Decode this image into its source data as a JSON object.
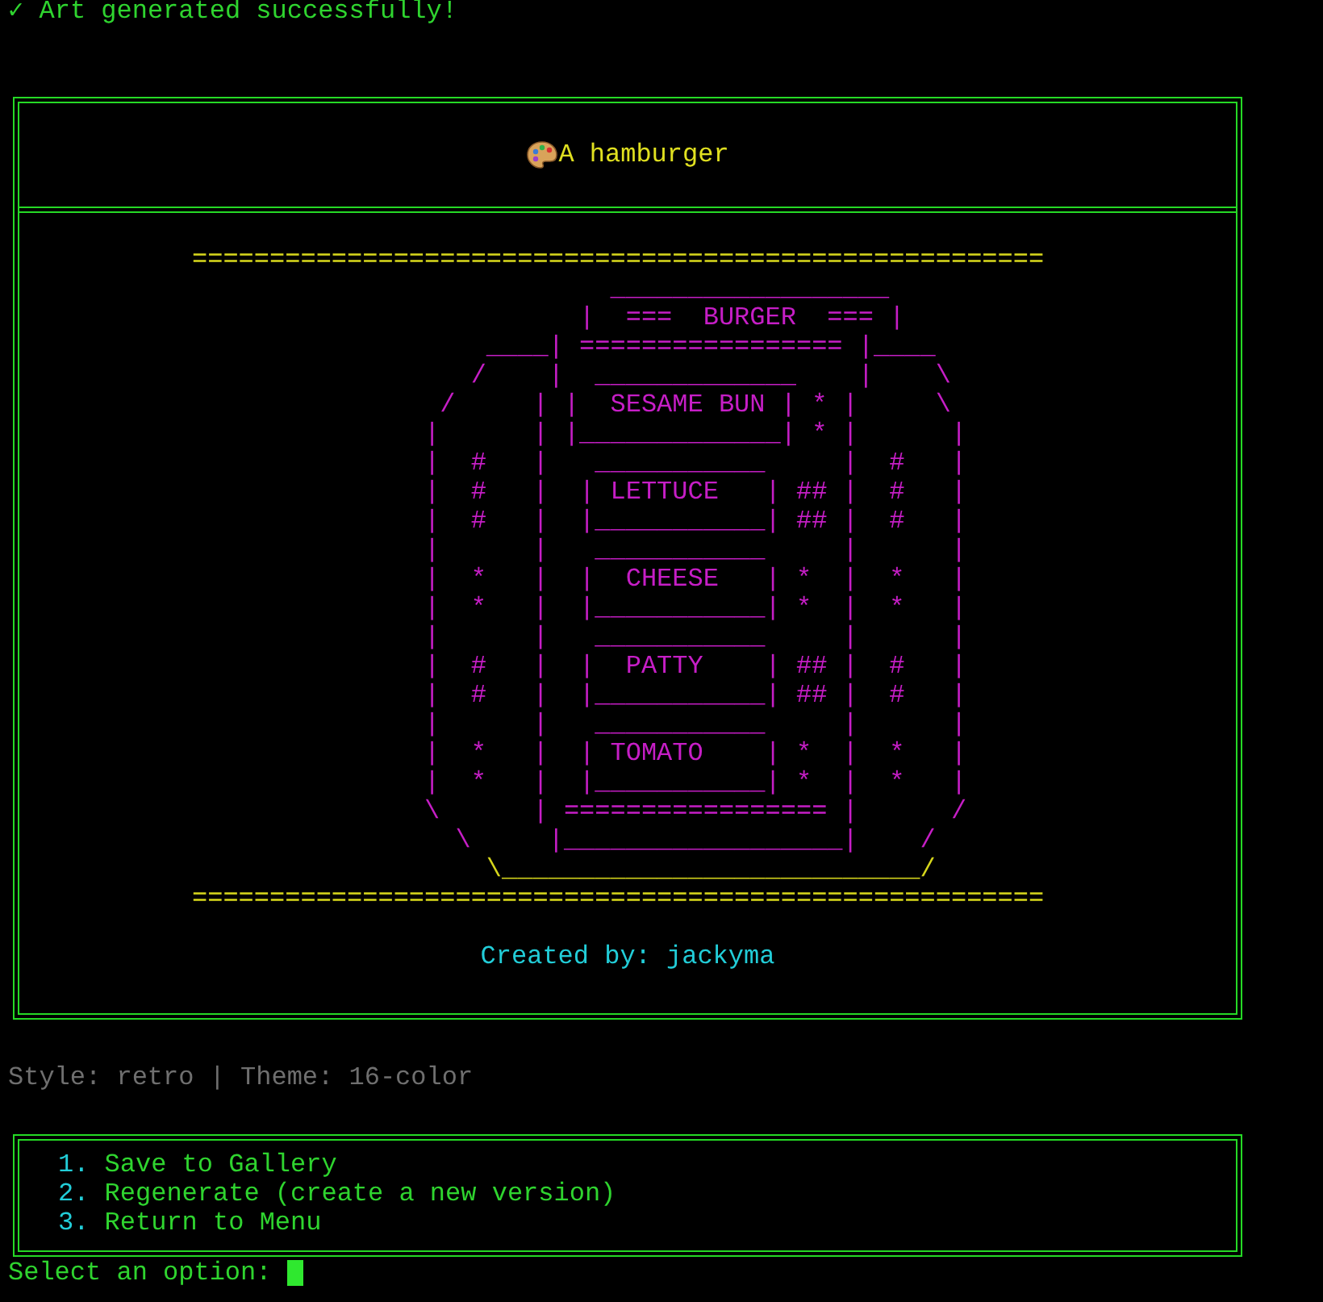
{
  "status_message": "✓ Art generated successfully!",
  "art_panel": {
    "title": "A hamburger",
    "lines": [
      {
        "text": "=======================================================",
        "color": "#d6d61c"
      },
      {
        "text": "                           __________________",
        "color": "#c61ec6"
      },
      {
        "text": "                         |  ===  BURGER  === |",
        "color": "#c61ec6"
      },
      {
        "text": "                   ____| ================= |____",
        "color": "#c61ec6"
      },
      {
        "text": "                  /    |  _____________    |    \\",
        "color": "#c61ec6"
      },
      {
        "text": "                /     | |  SESAME BUN | * |     \\",
        "color": "#c61ec6"
      },
      {
        "text": "               |      | |_____________| * |      |",
        "color": "#c61ec6"
      },
      {
        "text": "               |  #   |   ___________     |  #   |",
        "color": "#c61ec6"
      },
      {
        "text": "               |  #   |  | LETTUCE   | ## |  #   |",
        "color": "#c61ec6"
      },
      {
        "text": "               |  #   |  |___________| ## |  #   |",
        "color": "#c61ec6"
      },
      {
        "text": "               |      |   ___________     |      |",
        "color": "#c61ec6"
      },
      {
        "text": "               |  *   |  |  CHEESE   | *  |  *   |",
        "color": "#c61ec6"
      },
      {
        "text": "               |  *   |  |___________| *  |  *   |",
        "color": "#c61ec6"
      },
      {
        "text": "               |      |   ___________     |      |",
        "color": "#c61ec6"
      },
      {
        "text": "               |  #   |  |  PATTY    | ## |  #   |",
        "color": "#c61ec6"
      },
      {
        "text": "               |  #   |  |___________| ## |  #   |",
        "color": "#c61ec6"
      },
      {
        "text": "               |      |   ___________     |      |",
        "color": "#c61ec6"
      },
      {
        "text": "               |  *   |  | TOMATO    | *  |  *   |",
        "color": "#c61ec6"
      },
      {
        "text": "               |  *   |  |___________| *  |  *   |",
        "color": "#c61ec6"
      },
      {
        "text": "               \\      | ================= |      /",
        "color": "#c61ec6"
      },
      {
        "text": "                 \\     |__________________|    /",
        "color": "#c61ec6"
      },
      {
        "text": "                   \\___________________________/",
        "color": "#d6d61c"
      },
      {
        "text": "=======================================================",
        "color": "#d6d61c"
      }
    ],
    "credit": "Created by: jackyma"
  },
  "info_line": "Style: retro | Theme: 16-color",
  "menu": [
    {
      "number": "1.",
      "label": "Save to Gallery"
    },
    {
      "number": "2.",
      "label": "Regenerate (create a new version)"
    },
    {
      "number": "3.",
      "label": "Return to Menu"
    }
  ],
  "prompt": "Select an option:"
}
